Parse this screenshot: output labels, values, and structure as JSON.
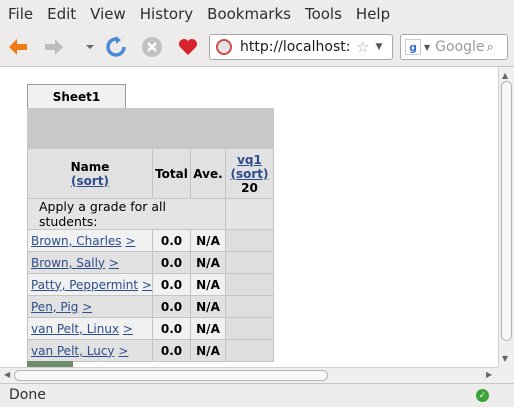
{
  "menu": {
    "items": [
      {
        "label": "File"
      },
      {
        "label": "Edit"
      },
      {
        "label": "View"
      },
      {
        "label": "History"
      },
      {
        "label": "Bookmarks"
      },
      {
        "label": "Tools"
      },
      {
        "label": "Help"
      }
    ]
  },
  "toolbar": {
    "url": "http://localhost:",
    "search_placeholder": "Google"
  },
  "sheet": {
    "tab": "Sheet1",
    "columns": {
      "name": "Name",
      "name_sort": "(sort)",
      "total": "Total",
      "ave": "Ave.",
      "vq": "vq1",
      "vq_sort": "(sort)",
      "vq_points": "20"
    },
    "apply_label": "Apply a grade for all students:",
    "students": [
      {
        "name": "Brown, Charles",
        "arrow": ">",
        "total": "0.0",
        "ave": "N/A"
      },
      {
        "name": "Brown, Sally",
        "arrow": ">",
        "total": "0.0",
        "ave": "N/A"
      },
      {
        "name": "Patty, Peppermint",
        "arrow": ">",
        "total": "0.0",
        "ave": "N/A"
      },
      {
        "name": "Pen, Pig",
        "arrow": ">",
        "total": "0.0",
        "ave": "N/A"
      },
      {
        "name": "van Pelt, Linux",
        "arrow": ">",
        "total": "0.0",
        "ave": "N/A"
      },
      {
        "name": "van Pelt, Lucy",
        "arrow": ">",
        "total": "0.0",
        "ave": "N/A"
      }
    ]
  },
  "status": {
    "text": "Done"
  }
}
